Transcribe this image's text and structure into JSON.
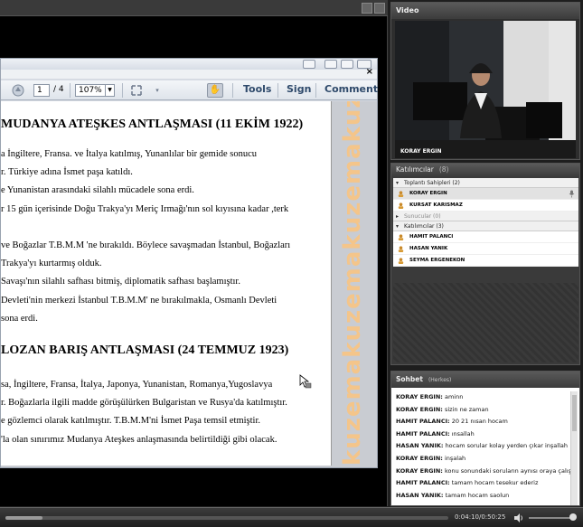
{
  "pdf": {
    "page_current": "1",
    "page_total": "/ 4",
    "zoom": "107%",
    "tools_label": "Tools",
    "sign_label": "Sign",
    "comment_label": "Comment",
    "heading1": "MUDANYA ATEŞKES ANTLAŞMASI (11 EKİM 1922)",
    "lines1": [
      "a İngiltere, Fransa. ve İtalya katılmış, Yunanlılar bir gemide sonucu",
      "r. Türkiye adına İsmet paşa katıldı.",
      "e Yunanistan arasındaki silahlı mücadele sona erdi.",
      "r 15 gün içerisinde Doğu Trakya'yı Meriç Irmağı'nın sol kıyısına kadar ,terk",
      "",
      "ve Boğazlar T.B.M.M 'ne bırakıldı. Böylece savaşmadan İstanbul, Boğazları",
      "Trakya'yı kurtarmış olduk.",
      "Savaşı'nın silahlı safhası bitmiş, diplomatik safhası başlamıştır.",
      "Devleti'nin merkezi İstanbul  T.B.M.M' ne bırakılmakla, Osmanlı Devleti",
      "sona erdi."
    ],
    "heading2": "LOZAN BARIŞ ANTLAŞMASI (24 TEMMUZ 1923)",
    "lines2": [
      "sa, İngiltere, Fransa, İtalya, Japonya, Yunanistan, Romanya,Yugoslavya",
      "r. Boğazlarla ilgili madde görüşülürken Bulgaristan ve Rusya'da katılmıştır.",
      "e gözlemci olarak  katılmıştır. T.B.M.M'ni  İsmet Paşa temsil etmiştir.",
      "'la olan sınırımız Mudanya Ateşkes anlaşmasında belirtildiği  gibi olacak."
    ],
    "watermark": "kuzemakuzemakuzemakuzemakuzemakuz"
  },
  "video": {
    "title": "Video",
    "presenter_name": "KORAY ERGIN"
  },
  "attendees": {
    "title": "Katılımcılar",
    "count": "(8)",
    "groups": [
      {
        "label": "Toplantı Sahipleri (2)",
        "collapsed": false,
        "people": [
          "KORAY ERGIN",
          "KURSAT KARISMAZ"
        ]
      },
      {
        "label": "Sunucular (0)",
        "collapsed": true,
        "people": []
      },
      {
        "label": "Katılımcılar (3)",
        "collapsed": false,
        "people": [
          "HAMIT PALANCI",
          "HASAN YANIK",
          "SEYMA ERGENEKON"
        ]
      }
    ]
  },
  "chat": {
    "title": "Sohbet",
    "audience": "(Herkes)",
    "messages": [
      {
        "sender": "KORAY ERGIN:",
        "text": "aminn"
      },
      {
        "sender": "KORAY ERGIN:",
        "text": "sizin ne zaman"
      },
      {
        "sender": "HAMIT PALANCI:",
        "text": "20 21 nısan hocam"
      },
      {
        "sender": "HAMIT PALANCI:",
        "text": "ınsallah"
      },
      {
        "sender": "HASAN YANIK:",
        "text": "hocam sorular kolay yerden çıkar inşallah"
      },
      {
        "sender": "KORAY ERGIN:",
        "text": "inşalah"
      },
      {
        "sender": "KORAY ERGIN:",
        "text": "konu sonundaki soruların aynısı oraya çalışınn"
      },
      {
        "sender": "HAMIT PALANCI:",
        "text": "tamam hocam tesekur ederiz"
      },
      {
        "sender": "HASAN YANIK:",
        "text": "tamam hocam saolun"
      }
    ]
  },
  "playback": {
    "time": "0:04:10/0:50:25",
    "progress": 0.083
  },
  "colors": {
    "watermark_orange": "#f4c58a",
    "watermark_blue": "#cfd8ea",
    "toolbar_button_text": "#2f4a6b",
    "pod_header": "#3c3c3c"
  }
}
